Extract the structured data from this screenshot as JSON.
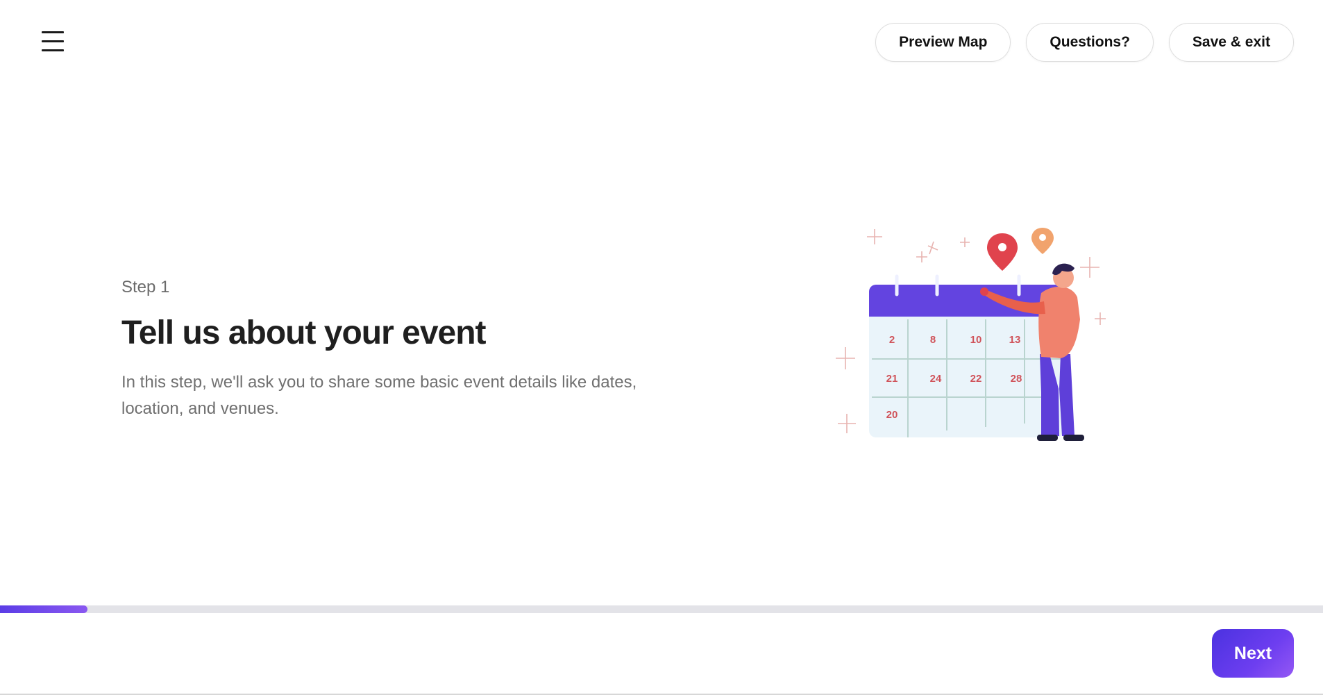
{
  "header": {
    "menu_icon": "hamburger-menu-icon",
    "actions": [
      {
        "label": "Preview Map"
      },
      {
        "label": "Questions?"
      },
      {
        "label": "Save & exit"
      }
    ]
  },
  "main": {
    "step_label": "Step 1",
    "title": "Tell us about your event",
    "description": "In this step, we'll ask you to share some basic event details like dates, location, and venues.",
    "illustration": {
      "icon": "calendar-person-illustration",
      "calendar_dates": [
        "2",
        "8",
        "10",
        "13",
        "21",
        "24",
        "22",
        "28",
        "20"
      ]
    }
  },
  "footer": {
    "progress": 0.066,
    "next_label": "Next"
  },
  "colors": {
    "accent": "#5b3de6",
    "accent_gradient_end": "#9458f4",
    "calendar_header": "#6344e0",
    "pin_red": "#e0434d",
    "pin_orange": "#f1a36d"
  }
}
